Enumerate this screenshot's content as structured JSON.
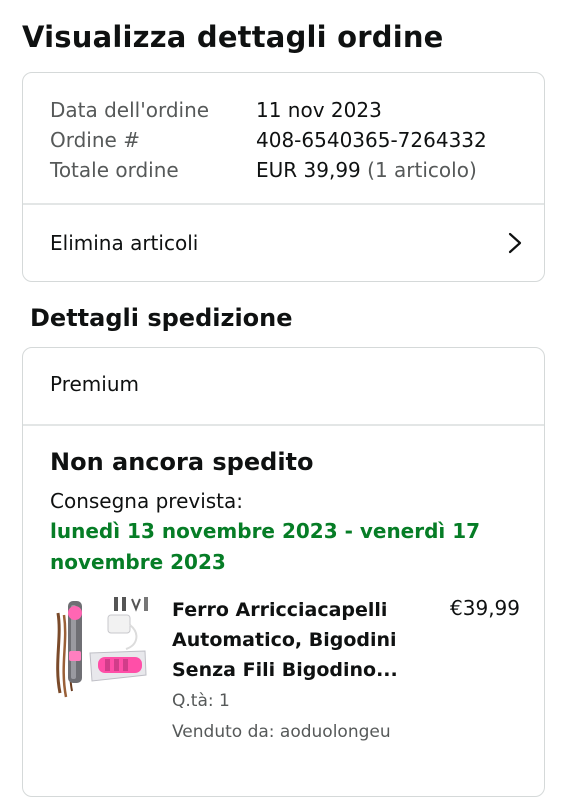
{
  "header": {
    "title": "Visualizza dettagli ordine"
  },
  "summary": {
    "rows": [
      {
        "label": "Data dell'ordine",
        "value": "11 nov 2023",
        "extra": ""
      },
      {
        "label": "Ordine #",
        "value": "408-6540365-7264332",
        "extra": ""
      },
      {
        "label": "Totale ordine",
        "value": "EUR 39,99",
        "extra": " (1 articolo)"
      }
    ],
    "delete_link": "Elimina articoli",
    "chevron_icon": "chevron-right-icon"
  },
  "shipment": {
    "section_title": "Dettagli spedizione",
    "method": "Premium",
    "status": "Non ancora spedito",
    "delivery_label": "Consegna prevista:",
    "delivery_date": "lunedì 13 novembre 2023 - venerdì 17 novembre 2023",
    "delivery_color": "#067d26",
    "product": {
      "title": "Ferro Arricciacapelli Automatico, Bigodini Senza Fili Bigodino...",
      "price": "€39,99",
      "qty": "Q.tà: 1",
      "seller": "Venduto da: aoduolongeu",
      "image_icon": "hair-curler-product-image"
    }
  }
}
